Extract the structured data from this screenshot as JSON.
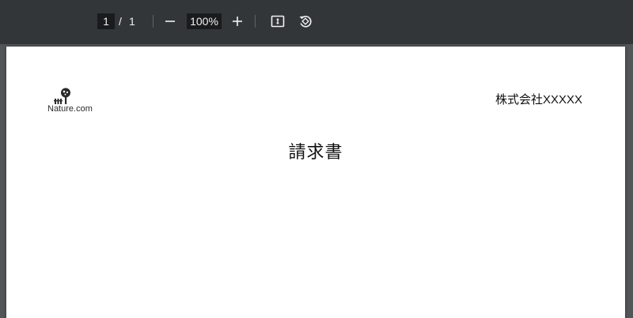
{
  "toolbar": {
    "page_current": "1",
    "page_separator": "/",
    "page_total": "1",
    "zoom_level": "100%",
    "zoom_out_icon": "minus-icon",
    "zoom_in_icon": "plus-icon",
    "fit_page_icon": "fit-to-page-icon",
    "rotate_icon": "rotate-icon"
  },
  "document": {
    "logo_text": "Nature.com",
    "company_name": "株式会社XXXXX",
    "title": "請求書"
  },
  "colors": {
    "toolbar_bg": "#323639",
    "viewer_bg": "#525659",
    "page_bg": "#ffffff"
  }
}
